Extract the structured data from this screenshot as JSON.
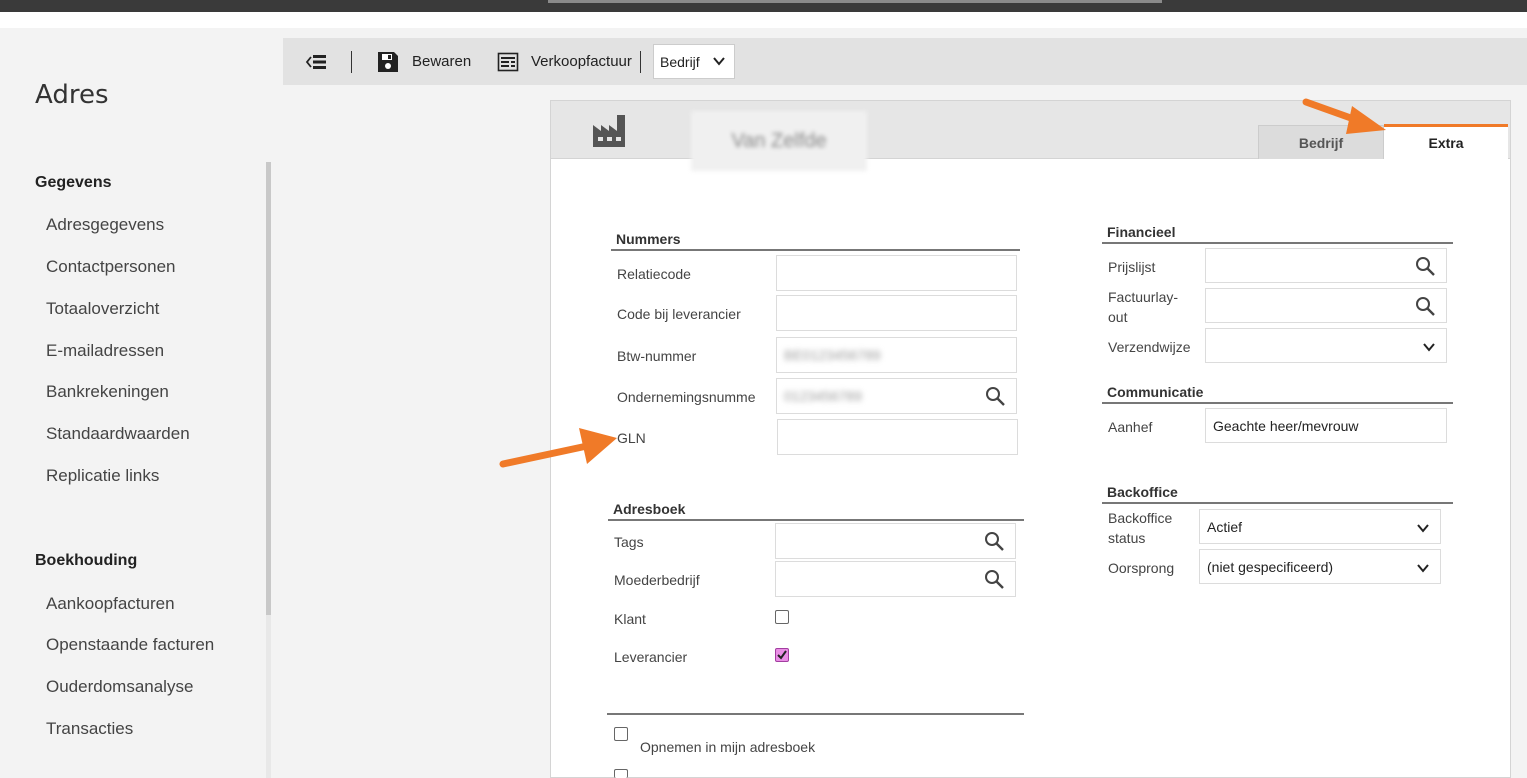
{
  "sidebar": {
    "title": "Adres",
    "sections": [
      {
        "heading": "Gegevens",
        "items": [
          "Adresgegevens",
          "Contactpersonen",
          "Totaaloverzicht",
          "E-mailadressen",
          "Bankrekeningen",
          "Standaardwaarden",
          "Replicatie links"
        ]
      },
      {
        "heading": "Boekhouding",
        "items": [
          "Aankoopfacturen",
          "Openstaande facturen",
          "Ouderdomsanalyse",
          "Transacties"
        ]
      }
    ]
  },
  "toolbar": {
    "save_label": "Bewaren",
    "invoice_label": "Verkoopfactuur",
    "select_value": "Bedrijf"
  },
  "card": {
    "company_name": "Van Zelfde",
    "tabs": [
      "Bedrijf",
      "Extra"
    ],
    "active_tab": "Extra"
  },
  "nummers": {
    "title": "Nummers",
    "relatiecode": "Relatiecode",
    "code_leverancier": "Code bij leverancier",
    "btw": "Btw-nummer",
    "btw_value": "BE0123456789",
    "ondernemingsnummer": "Ondernemingsnumme",
    "ondernemingsnummer_value": "0123456789",
    "gln": "GLN"
  },
  "adresboek": {
    "title": "Adresboek",
    "tags": "Tags",
    "moederbedrijf": "Moederbedrijf",
    "klant": "Klant",
    "klant_checked": false,
    "leverancier": "Leverancier",
    "leverancier_checked": true,
    "opnemen": "Opnemen in mijn adresboek"
  },
  "financieel": {
    "title": "Financieel",
    "prijslijst": "Prijslijst",
    "factuurlayout_1": "Factuurlay-",
    "factuurlayout_2": "out",
    "verzendwijze": "Verzendwijze"
  },
  "communicatie": {
    "title": "Communicatie",
    "aanhef": "Aanhef",
    "aanhef_value": "Geachte heer/mevrouw"
  },
  "backoffice": {
    "title": "Backoffice",
    "status_1": "Backoffice",
    "status_2": "status",
    "status_value": "Actief",
    "oorsprong": "Oorsprong",
    "oorsprong_value": "(niet gespecificeerd)"
  },
  "colors": {
    "accent": "#f07a28",
    "checkbox_checked": "#ea8ee6"
  }
}
